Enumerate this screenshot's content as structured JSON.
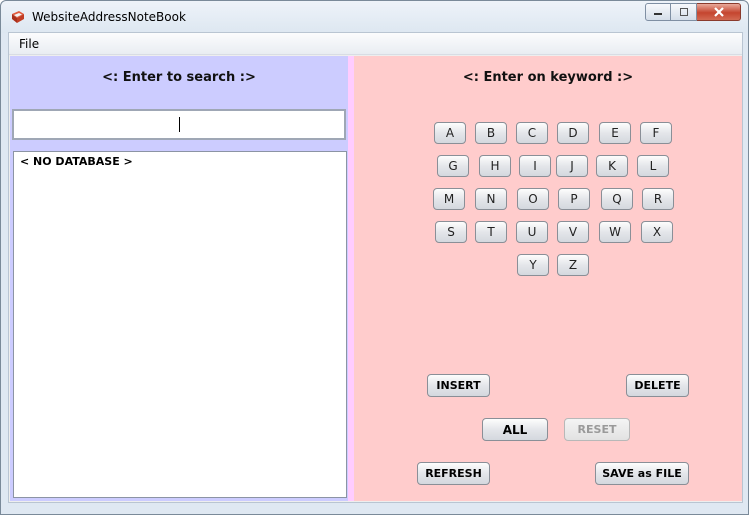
{
  "window": {
    "title": "WebsiteAddressNoteBook"
  },
  "menu": {
    "file": "File"
  },
  "left": {
    "title": "<: Enter to search :>",
    "search_value": "",
    "list_items": [
      "< NO DATABASE >"
    ]
  },
  "right": {
    "title": "<: Enter on keyword :>",
    "letters": [
      "A",
      "B",
      "C",
      "D",
      "E",
      "F",
      "G",
      "H",
      "I",
      "J",
      "K",
      "L",
      "M",
      "N",
      "O",
      "P",
      "Q",
      "R",
      "S",
      "T",
      "U",
      "V",
      "W",
      "X",
      "Y",
      "Z"
    ],
    "buttons": {
      "insert": "INSERT",
      "delete": "DELETE",
      "all": "ALL",
      "reset": "RESET",
      "refresh": "REFRESH",
      "save": "SAVE as FILE"
    }
  },
  "colors": {
    "left_panel": "#ccccff",
    "right_panel": "#ffcccc",
    "divider": "#ffccff"
  }
}
